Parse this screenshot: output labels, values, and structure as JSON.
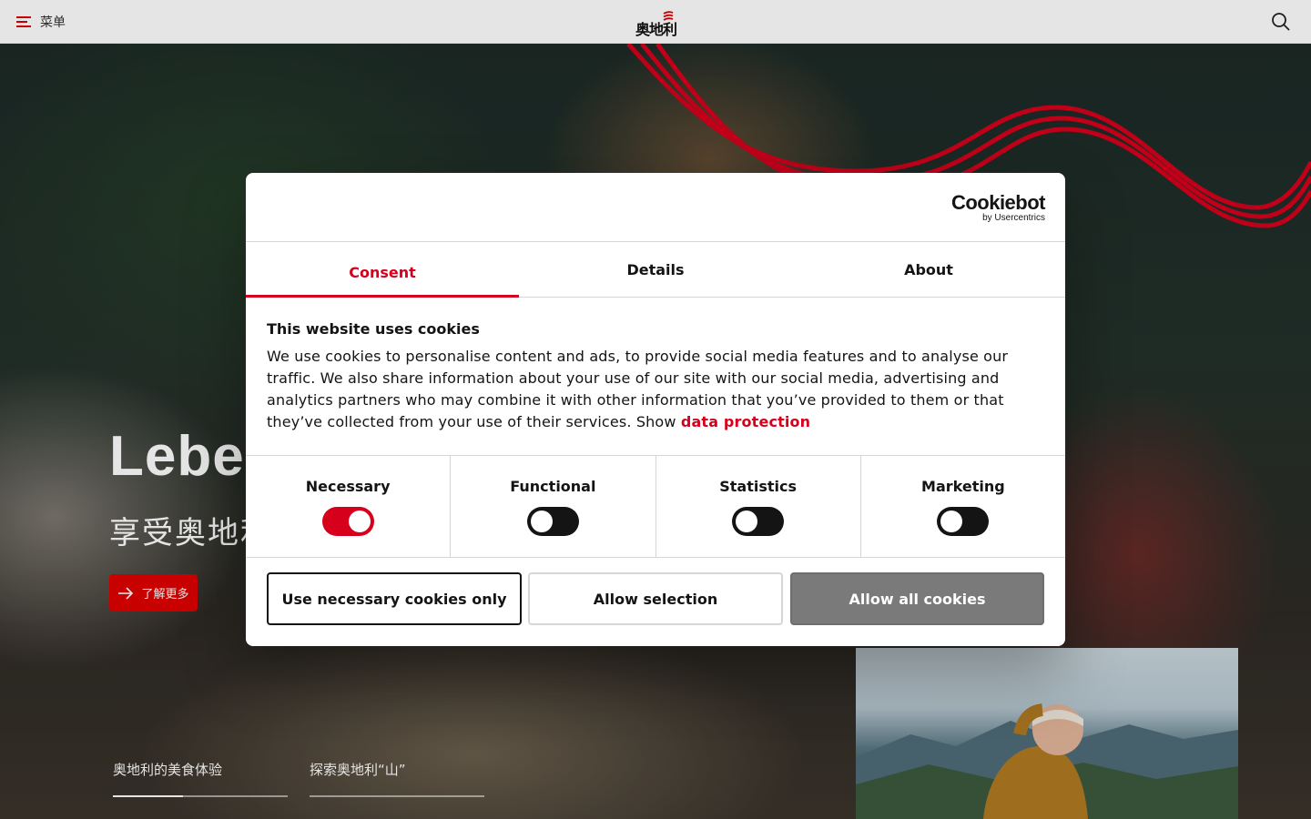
{
  "header": {
    "menu_label": "菜单",
    "logo_text": "奥地利",
    "icons": {
      "menu": "hamburger-icon",
      "search": "search-icon"
    },
    "brand_color": "#e00000"
  },
  "hero": {
    "title": "Lebe",
    "subtitle": "享受奥地利的生活",
    "cta_label": "了解更多",
    "tabs": [
      {
        "label": "奥地利的美食体验",
        "progress": 0.4
      },
      {
        "label": "探索奥地利“山”",
        "progress": 0
      }
    ]
  },
  "cookie_dialog": {
    "brand_name": "Cookiebot",
    "brand_sub": "by Usercentrics",
    "tabs": [
      {
        "label": "Consent",
        "active": true
      },
      {
        "label": "Details",
        "active": false
      },
      {
        "label": "About",
        "active": false
      }
    ],
    "title": "This website uses cookies",
    "body_text": "We use cookies to personalise content and ads, to provide social media features and to analyse our traffic. We also share information about your use of our site with our social media, advertising and analytics partners who may combine it with other information that you’ve provided to them or that they’ve collected from your use of their services. Show ",
    "body_link": "data protection",
    "categories": [
      {
        "label": "Necessary",
        "enabled": true
      },
      {
        "label": "Functional",
        "enabled": false
      },
      {
        "label": "Statistics",
        "enabled": false
      },
      {
        "label": "Marketing",
        "enabled": false
      }
    ],
    "buttons": {
      "necessary_only": "Use necessary cookies only",
      "allow_selection": "Allow selection",
      "allow_all": "Allow all cookies"
    },
    "accent_color": "#d6001c"
  }
}
